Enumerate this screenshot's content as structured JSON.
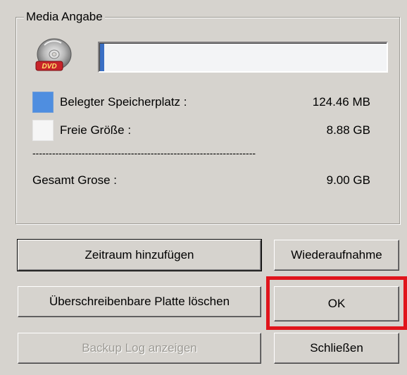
{
  "group": {
    "title": "Media Angabe"
  },
  "disc": {
    "icon": "cd-disc-icon",
    "badge_text": "DVD"
  },
  "progress": {
    "fraction": 0.014
  },
  "stats": {
    "used_label": "Belegter Speicherplatz :",
    "used_value": "124.46 MB",
    "free_label": "Freie Größe :",
    "free_value": "8.88 GB",
    "separator": "--------------------------------------------------------------------",
    "total_label": "Gesamt Grose :",
    "total_value": "9.00 GB"
  },
  "buttons": {
    "add_period": "Zeitraum hinzufügen",
    "resume": "Wiederaufnahme",
    "erase_disc": "Überschreibenbare Platte löschen",
    "ok": "OK",
    "show_log": "Backup Log anzeigen",
    "close": "Schließen"
  },
  "colors": {
    "used_swatch": "#4f8ee0",
    "free_swatch": "#f6f6f6",
    "highlight": "#e0141b",
    "dialog_bg": "#d6d3ce"
  }
}
